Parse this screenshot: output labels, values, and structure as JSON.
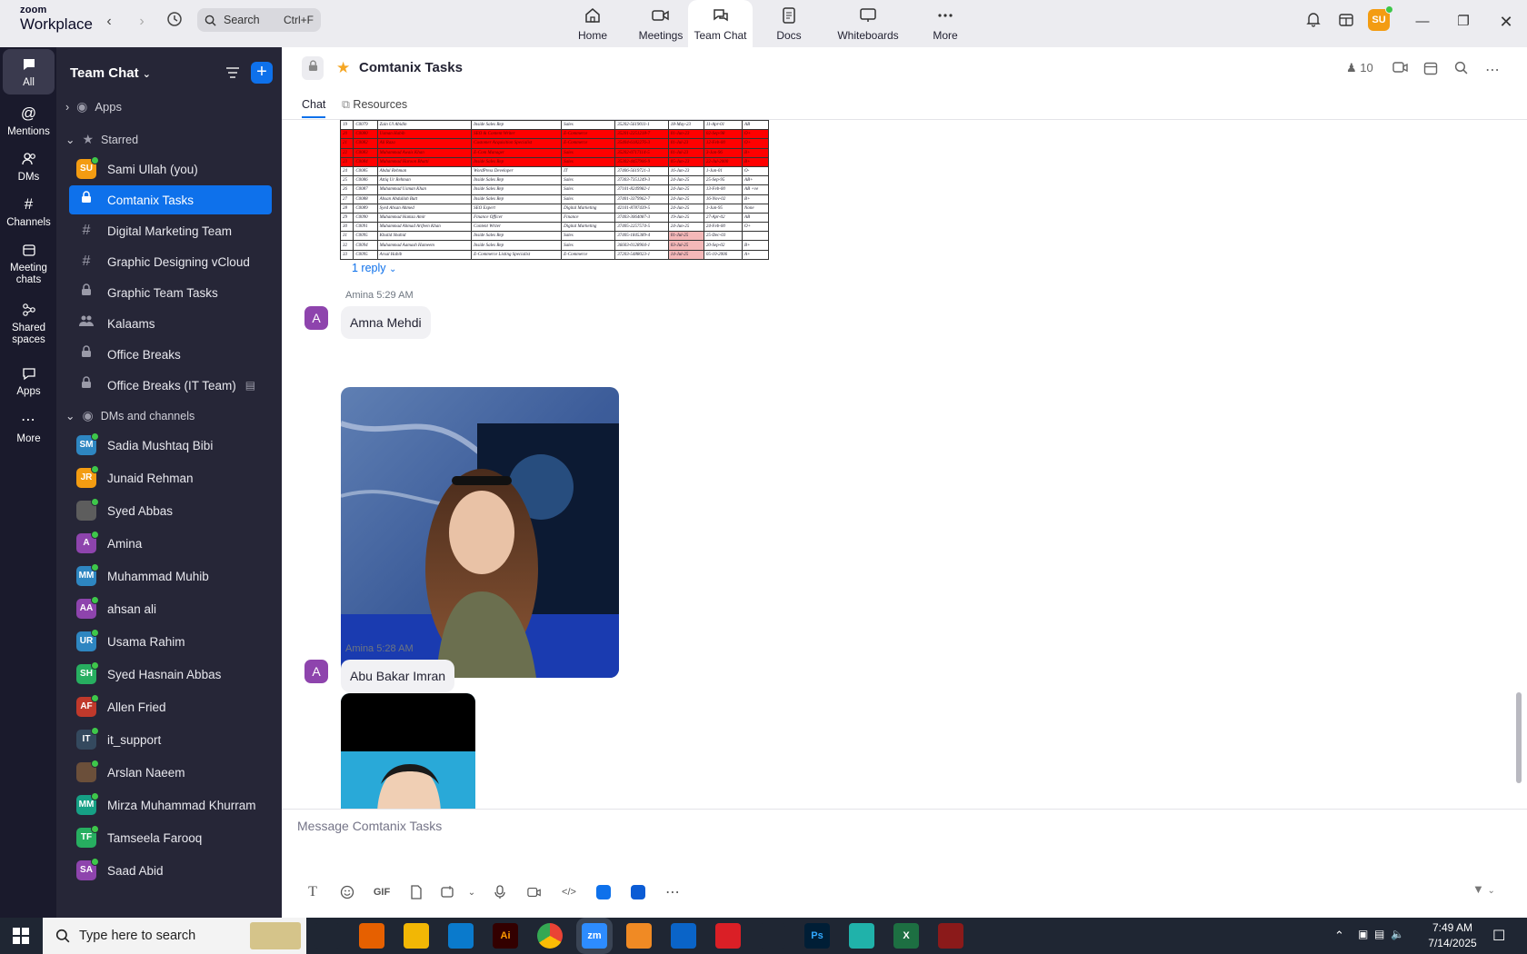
{
  "window": {
    "logo_top": "zoom",
    "logo_bottom": "Workplace",
    "search_label": "Search",
    "search_shortcut": "Ctrl+F",
    "nav_tabs": [
      {
        "label": "Home",
        "icon": "home-icon"
      },
      {
        "label": "Meetings",
        "icon": "video-icon"
      },
      {
        "label": "Team Chat",
        "icon": "chat-icon",
        "active": true
      },
      {
        "label": "Docs",
        "icon": "doc-icon"
      },
      {
        "label": "Whiteboards",
        "icon": "whiteboard-icon"
      },
      {
        "label": "More",
        "icon": "more-dots-icon"
      }
    ],
    "user_initials": "SU"
  },
  "rail": {
    "items": [
      {
        "label": "All",
        "icon": "chat-bubble-icon",
        "active": true
      },
      {
        "label": "Mentions",
        "icon": "at-icon"
      },
      {
        "label": "DMs",
        "icon": "people-icon"
      },
      {
        "label": "Channels",
        "icon": "hash-icon"
      },
      {
        "label": "Meeting chats",
        "icon": "calendar-icon"
      },
      {
        "label": "Shared spaces",
        "icon": "share-icon"
      },
      {
        "label": "Apps",
        "icon": "apps-icon"
      },
      {
        "label": "More",
        "icon": "more-dots-icon"
      }
    ]
  },
  "sidebar": {
    "title": "Team Chat",
    "apps_label": "Apps",
    "starred_label": "Starred",
    "dms_label": "DMs and channels",
    "starred": [
      {
        "label": "Sami Ullah (you)",
        "kind": "avatar",
        "initials": "SU",
        "color": "#f39c12"
      },
      {
        "label": "Comtanix Tasks",
        "kind": "lock",
        "selected": true
      },
      {
        "label": "Digital Marketing Team",
        "kind": "hash"
      },
      {
        "label": "Graphic Designing vCloud",
        "kind": "hash"
      },
      {
        "label": "Graphic Team Tasks",
        "kind": "lock"
      },
      {
        "label": "Kalaams",
        "kind": "group"
      },
      {
        "label": "Office Breaks",
        "kind": "lock"
      },
      {
        "label": "Office Breaks (IT Team)",
        "kind": "lock"
      }
    ],
    "dms": [
      {
        "label": "Sadia Mushtaq Bibi",
        "initials": "SM",
        "color": "#2e86c1"
      },
      {
        "label": "Junaid Rehman",
        "initials": "JR",
        "color": "#f39c12"
      },
      {
        "label": "Syed Abbas",
        "initials": "",
        "color": "#5d5d5d"
      },
      {
        "label": "Amina",
        "initials": "A",
        "color": "#8e44ad"
      },
      {
        "label": "Muhammad Muhib",
        "initials": "MM",
        "color": "#2e86c1"
      },
      {
        "label": "ahsan ali",
        "initials": "AA",
        "color": "#8e44ad"
      },
      {
        "label": "Usama Rahim",
        "initials": "UR",
        "color": "#2e86c1"
      },
      {
        "label": "Syed Hasnain Abbas",
        "initials": "SH",
        "color": "#27ae60"
      },
      {
        "label": "Allen Fried",
        "initials": "AF",
        "color": "#c0392b"
      },
      {
        "label": "it_support",
        "initials": "IT",
        "color": "#34495e"
      },
      {
        "label": "Arslan Naeem",
        "initials": "",
        "color": "#6b4f3a"
      },
      {
        "label": "Mirza Muhammad Khurram",
        "initials": "MM",
        "color": "#16a085"
      },
      {
        "label": "Tamseela Farooq",
        "initials": "TF",
        "color": "#27ae60"
      },
      {
        "label": "Saad Abid",
        "initials": "SA",
        "color": "#8e44ad"
      }
    ]
  },
  "channel": {
    "title": "Comtanix Tasks",
    "member_count": "10",
    "tabs": [
      "Chat",
      "Resources"
    ]
  },
  "messages": {
    "reply_label": "1 reply",
    "sheet_rows": [
      {
        "n": "19",
        "id": "C0079",
        "name": "Zain Ul Abidin",
        "role": "Inside Sales Rep",
        "dept": "Sales",
        "cnic": "35202-5619011-1",
        "d1": "18-May-23",
        "d2": "11-Apr-01",
        "bg": "AB",
        "red": false
      },
      {
        "n": "20",
        "id": "C0080",
        "name": "Usman Habib",
        "role": "SEO & Content Writer",
        "dept": "E-Commerce",
        "cnic": "35201-2251218-7",
        "d1": "01-Jun-23",
        "d2": "02-Sep-98",
        "bg": "O+",
        "red": true
      },
      {
        "n": "21",
        "id": "C0082",
        "name": "Ali Raza",
        "role": "Customer Acquisition Specialist",
        "dept": "E-Commerce",
        "cnic": "35404-6182276-3",
        "d1": "01-Jul-23",
        "d2": "12-Feb-00",
        "bg": "O+",
        "red": true
      },
      {
        "n": "22",
        "id": "C0083",
        "name": "Muhammad Awais Khan",
        "role": "E-Com Manager",
        "dept": "Sales",
        "cnic": "35202-0717114-5",
        "d1": "01-Jul-23",
        "d2": "3-Jan-96",
        "bg": "B+",
        "red": true
      },
      {
        "n": "23",
        "id": "C0084",
        "name": "Muhammad Haroon Bhatti",
        "role": "Inside Sales Rep",
        "dept": "Sales",
        "cnic": "35302-4457906-9",
        "d1": "05-Jun-23",
        "d2": "22-Jul-2000",
        "bg": "B+",
        "red": true
      },
      {
        "n": "24",
        "id": "C0085",
        "name": "Abdul Rehman",
        "role": "WordPress Developer",
        "dept": "IT",
        "cnic": "37406-5619721-3",
        "d1": "16-Jun-23",
        "d2": "1-Jun-01",
        "bg": "O-",
        "red": false
      },
      {
        "n": "25",
        "id": "C0086",
        "name": "Attiq Ur Rehman",
        "role": "Inside Sales Rep",
        "dept": "Sales",
        "cnic": "37303-7351249-3",
        "d1": "24-Jun-25",
        "d2": "25-Sep-95",
        "bg": "AB+",
        "red": false
      },
      {
        "n": "26",
        "id": "C0087",
        "name": "Muhammad Usman Khan",
        "role": "Inside Sales Rep",
        "dept": "Sales",
        "cnic": "37101-8249982-1",
        "d1": "24-Jun-25",
        "d2": "13-Feb-00",
        "bg": "AB +ve",
        "red": false
      },
      {
        "n": "27",
        "id": "C0088",
        "name": "Ahsan Abdullah Butt",
        "role": "Inside Sales Rep",
        "dept": "Sales",
        "cnic": "37401-3379962-7",
        "d1": "24-Jun-25",
        "d2": "16-Nov-02",
        "bg": "B+",
        "red": false
      },
      {
        "n": "28",
        "id": "C0089",
        "name": "Syed Ahsan Ahmed",
        "role": "SEO Expert",
        "dept": "Digital Marketing",
        "cnic": "42101-8787439-5",
        "d1": "24-Jun-25",
        "d2": "1-Jun-95",
        "bg": "None",
        "red": false
      },
      {
        "n": "29",
        "id": "C0090",
        "name": "Muhammad Hamza Amir",
        "role": "Finance Officer",
        "dept": "Finance",
        "cnic": "37403-3064087-3",
        "d1": "19-Jun-25",
        "d2": "27-Apr-02",
        "bg": "AB",
        "red": false
      },
      {
        "n": "30",
        "id": "C0091",
        "name": "Muhammad Ahmad Arifeen Khan",
        "role": "Content Writer",
        "dept": "Digital Marketing",
        "cnic": "37405-2257574-5",
        "d1": "24-Jun-25",
        "d2": "24-Feb-00",
        "bg": "O+",
        "red": false
      },
      {
        "n": "31",
        "id": "C0095",
        "name": "Khalid Shahid",
        "role": "Inside Sales Rep",
        "dept": "Sales",
        "cnic": "37405-1845389-4",
        "d1": "01-Jul-25",
        "d2": "25-Dec-03",
        "bg": "",
        "red": false
      },
      {
        "n": "32",
        "id": "C0094",
        "name": "Muhammad Aamash Hameem",
        "role": "Inside Sales Rep",
        "dept": "Sales",
        "cnic": "36603-0128904-1",
        "d1": "03-Jul-25",
        "d2": "20-Sep-02",
        "bg": "B+",
        "red": false
      },
      {
        "n": "33",
        "id": "C0095",
        "name": "Arsal Habib",
        "role": "E-Commerce Listing Specialist",
        "dept": "E-Commerce",
        "cnic": "37203-5488023-1",
        "d1": "14-Jul-25",
        "d2": "05-10-2006",
        "bg": "A+",
        "red": false
      }
    ],
    "items": [
      {
        "sender": "Amina",
        "time": "5:29 AM",
        "avatar": "A",
        "text": "Amna Mehdi"
      },
      {
        "sender": "Amina",
        "time": "5:28 AM",
        "avatar": "A",
        "text": "Abu Bakar Imran"
      }
    ]
  },
  "compose": {
    "placeholder": "Message Comtanix Tasks",
    "gif_label": "GIF"
  },
  "taskbar": {
    "search_placeholder": "Type here to search",
    "time": "7:49 AM",
    "date": "7/14/2025",
    "apps": [
      {
        "icon": "task-view-icon",
        "label": ""
      },
      {
        "icon": "firefox-icon",
        "label": ""
      },
      {
        "icon": "file-explorer-icon",
        "label": ""
      },
      {
        "icon": "vscode-icon",
        "label": ""
      },
      {
        "icon": "illustrator-icon",
        "label": "Ai"
      },
      {
        "icon": "chrome-icon",
        "label": ""
      },
      {
        "icon": "zoom-icon",
        "label": "zm"
      },
      {
        "icon": "app-icon",
        "label": ""
      },
      {
        "icon": "outlook-icon",
        "label": ""
      },
      {
        "icon": "creative-cloud-icon",
        "label": ""
      },
      {
        "icon": "pen-icon",
        "label": ""
      },
      {
        "icon": "photoshop-icon",
        "label": "Ps"
      },
      {
        "icon": "app2-icon",
        "label": ""
      },
      {
        "icon": "excel-icon",
        "label": "X"
      },
      {
        "icon": "winrar-icon",
        "label": ""
      }
    ]
  }
}
